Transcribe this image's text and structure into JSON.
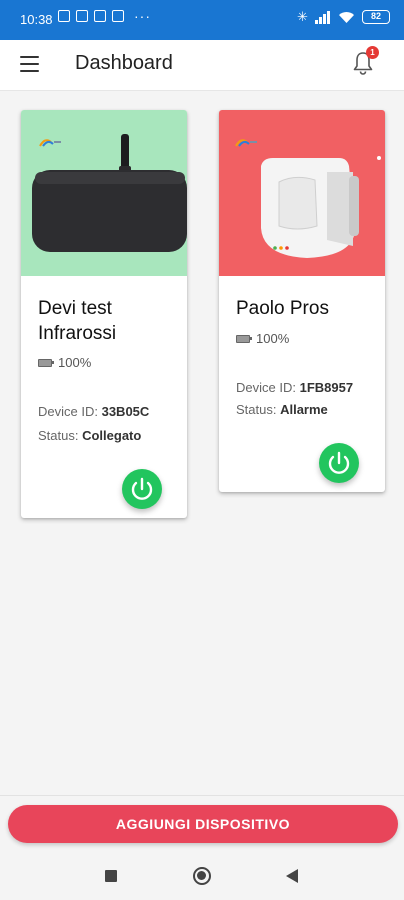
{
  "status_bar": {
    "time": "10:38",
    "more": "···",
    "battery": "82"
  },
  "app_bar": {
    "title": "Dashboard",
    "notification_count": "1"
  },
  "devices": [
    {
      "name": "Devi test Infrarossi",
      "battery": "100%",
      "device_id_label": "Device ID:",
      "device_id": "33B05C",
      "status_label": "Status:",
      "status": "Collegato",
      "image_bg": "#a8e6bd"
    },
    {
      "name": "Paolo Pros",
      "battery": "100%",
      "device_id_label": "Device ID:",
      "device_id": "1FB8957",
      "status_label": "Status:",
      "status": "Allarme",
      "image_bg": "#f16063"
    }
  ],
  "add_device_label": "AGGIUNGI DISPOSITIVO",
  "colors": {
    "status_bar": "#1976d2",
    "power_button": "#22c55e",
    "add_button": "#e8455a"
  }
}
